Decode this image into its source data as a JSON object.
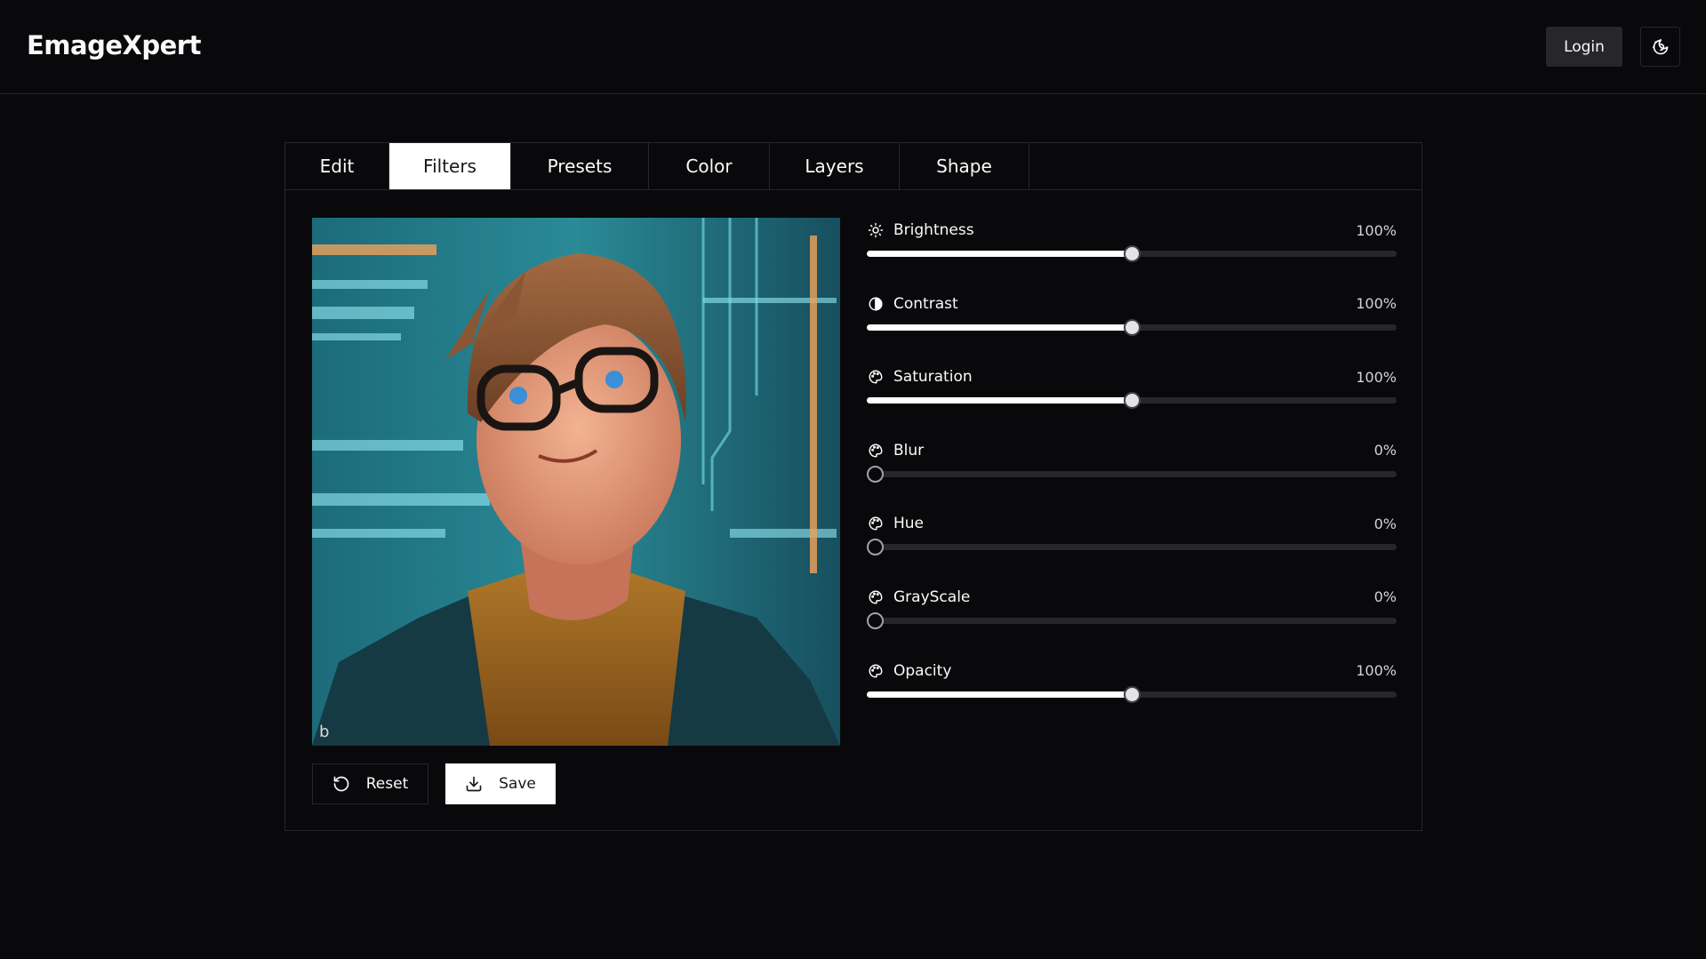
{
  "app": {
    "title": "EmageXpert"
  },
  "header": {
    "login_label": "Login",
    "theme_icon": "moon-sun-icon"
  },
  "tabs": [
    {
      "label": "Edit",
      "active": false
    },
    {
      "label": "Filters",
      "active": true
    },
    {
      "label": "Presets",
      "active": false
    },
    {
      "label": "Color",
      "active": false
    },
    {
      "label": "Layers",
      "active": false
    },
    {
      "label": "Shape",
      "active": false
    }
  ],
  "image": {
    "watermark": "b"
  },
  "actions": {
    "reset_label": "Reset",
    "save_label": "Save",
    "reset_icon": "rotate-ccw-icon",
    "save_icon": "download-icon"
  },
  "filters": [
    {
      "name": "brightness",
      "label": "Brightness",
      "value": "100%",
      "level": 0.5,
      "icon": "sun-icon"
    },
    {
      "name": "contrast",
      "label": "Contrast",
      "value": "100%",
      "level": 0.5,
      "icon": "contrast-icon"
    },
    {
      "name": "saturation",
      "label": "Saturation",
      "value": "100%",
      "level": 0.5,
      "icon": "palette-icon"
    },
    {
      "name": "blur",
      "label": "Blur",
      "value": "0%",
      "level": 0,
      "icon": "palette-icon"
    },
    {
      "name": "hue",
      "label": "Hue",
      "value": "0%",
      "level": 0,
      "icon": "palette-icon"
    },
    {
      "name": "grayscale",
      "label": "GrayScale",
      "value": "0%",
      "level": 0,
      "icon": "palette-icon"
    },
    {
      "name": "opacity",
      "label": "Opacity",
      "value": "100%",
      "level": 0.5,
      "icon": "palette-icon"
    }
  ],
  "colors": {
    "background": "#09090b",
    "border": "#27272a",
    "accent": "#ffffff",
    "track": "#27272a"
  }
}
